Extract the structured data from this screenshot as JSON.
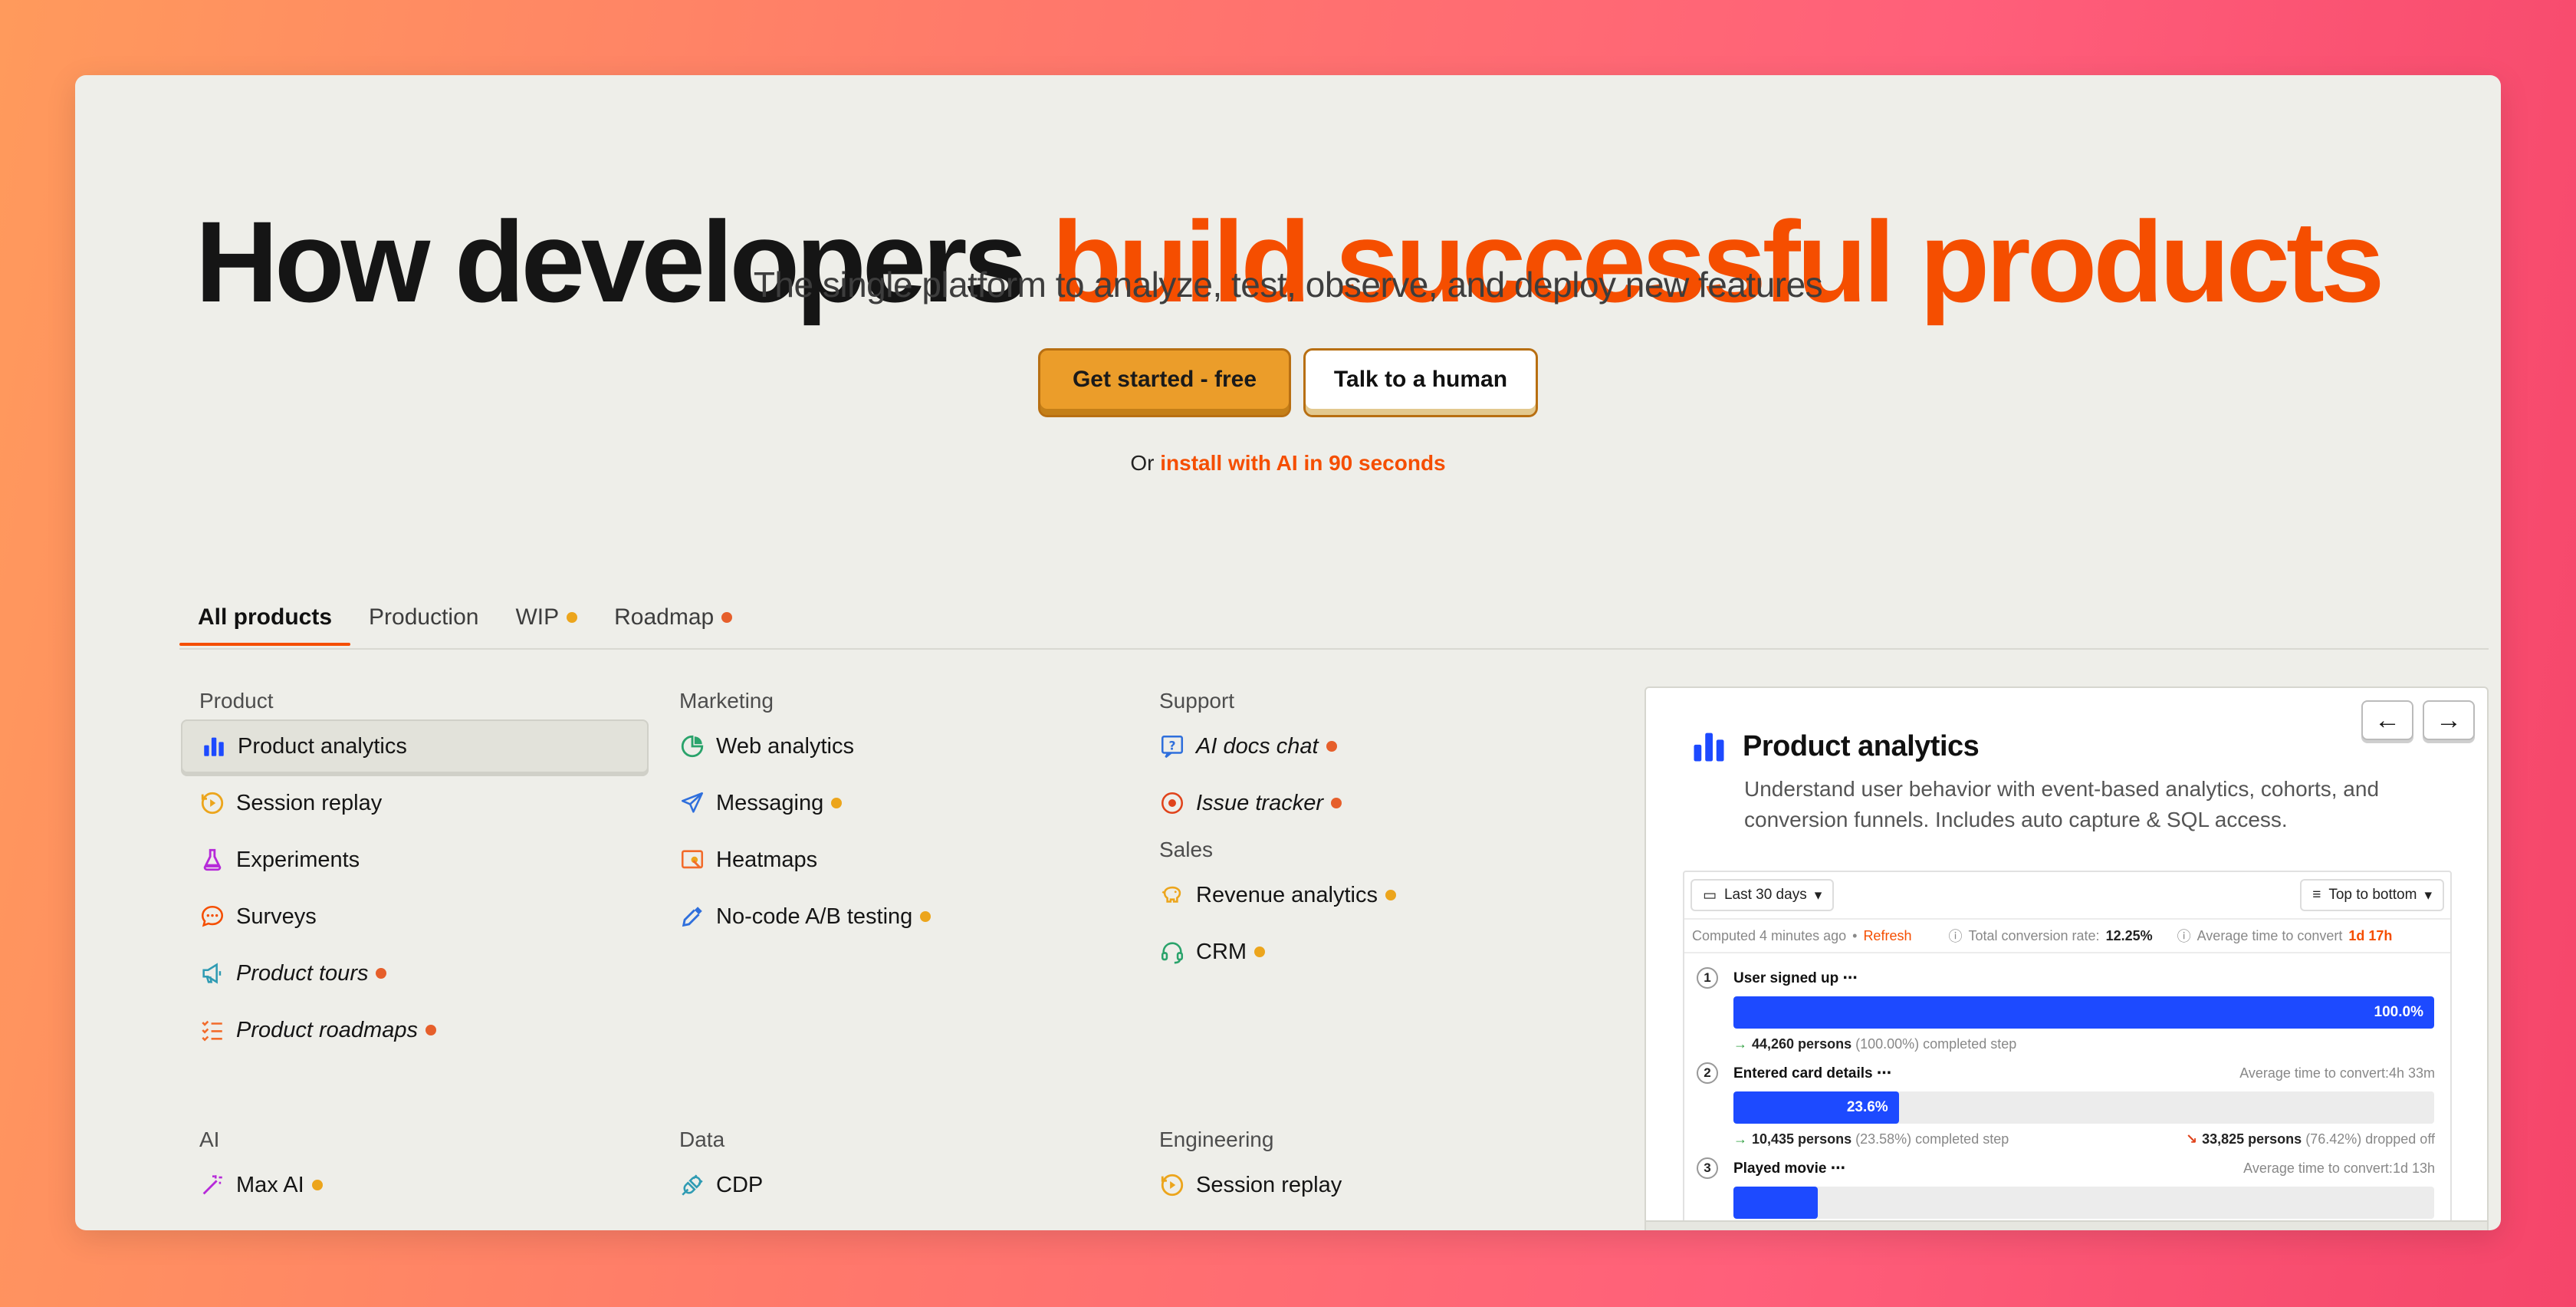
{
  "hero": {
    "title_main": "How developers ",
    "title_accent": "build successful products",
    "subtitle": "The single platform to analyze, test, observe, and deploy new features",
    "cta_primary": "Get started - free",
    "cta_secondary": "Talk to a human",
    "install_prefix": "Or ",
    "install_link": "install with AI in 90 seconds"
  },
  "tabs": [
    {
      "label": "All products",
      "active": true
    },
    {
      "label": "Production"
    },
    {
      "label": "WIP",
      "dot": "#eca51c"
    },
    {
      "label": "Roadmap",
      "dot": "#e65f2b"
    }
  ],
  "columns": {
    "product": {
      "heading": "Product",
      "items": [
        {
          "label": "Product analytics",
          "icon": "bar-chart-icon"
        },
        {
          "label": "Session replay",
          "icon": "replay-icon"
        },
        {
          "label": "Experiments",
          "icon": "flask-icon"
        },
        {
          "label": "Surveys",
          "icon": "chat-bubble-icon"
        },
        {
          "label": "Product tours",
          "icon": "megaphone-icon",
          "status": "roadmap"
        },
        {
          "label": "Product roadmaps",
          "icon": "checklist-icon",
          "status": "roadmap"
        }
      ]
    },
    "marketing": {
      "heading": "Marketing",
      "items": [
        {
          "label": "Web analytics",
          "icon": "pie-chart-icon"
        },
        {
          "label": "Messaging",
          "icon": "paper-plane-icon",
          "status": "wip"
        },
        {
          "label": "Heatmaps",
          "icon": "heatmap-icon"
        },
        {
          "label": "No-code A/B testing",
          "icon": "dropper-icon",
          "status": "wip"
        }
      ]
    },
    "support": {
      "heading": "Support",
      "items": [
        {
          "label": "AI docs chat",
          "icon": "help-doc-icon",
          "status": "roadmap"
        },
        {
          "label": "Issue tracker",
          "icon": "target-icon",
          "status": "roadmap"
        }
      ]
    },
    "sales": {
      "heading": "Sales",
      "items": [
        {
          "label": "Revenue analytics",
          "icon": "piggy-bank-icon",
          "status": "wip"
        },
        {
          "label": "CRM",
          "icon": "headset-icon",
          "status": "wip"
        }
      ]
    },
    "ai": {
      "heading": "AI",
      "items": [
        {
          "label": "Max AI",
          "icon": "magic-wand-icon",
          "status": "wip"
        }
      ]
    },
    "data": {
      "heading": "Data",
      "items": [
        {
          "label": "CDP",
          "icon": "plug-icon"
        }
      ]
    },
    "engineering": {
      "heading": "Engineering",
      "items": [
        {
          "label": "Session replay",
          "icon": "replay-icon"
        }
      ]
    }
  },
  "colors": {
    "accent": "#f54e00",
    "wip": "#eca51c",
    "roadmap": "#e65f2b",
    "funnel_bar": "#1d4aff"
  },
  "panel": {
    "title": "Product analytics",
    "description": "Understand user behavior with event-based analytics, cohorts, and conversion funnels. Includes auto capture & SQL access.",
    "prev_label": "←",
    "next_label": "→",
    "funnel": {
      "date_range": "Last 30 days",
      "layout": "Top to bottom",
      "computed": "Computed 4 minutes ago",
      "separator": "•",
      "refresh": "Refresh",
      "total_label": "Total conversion rate:",
      "total_value": "12.25%",
      "avg_label": "Average time to convert",
      "avg_value": "1d 17h",
      "steps": [
        {
          "num": "1",
          "name": "User signed up",
          "menu": "⋯",
          "pct": 100.0,
          "pct_label": "100.0%",
          "completed": "44,260 persons",
          "completed_pct": "(100.00%)",
          "completed_suffix": "completed step",
          "avg": "",
          "dropped": "",
          "dropped_pct": "",
          "dropped_suffix": ""
        },
        {
          "num": "2",
          "name": "Entered card details",
          "menu": "⋯",
          "pct": 23.6,
          "pct_label": "23.6%",
          "completed": "10,435 persons",
          "completed_pct": "(23.58%)",
          "completed_suffix": "completed step",
          "avg": "Average time to convert:4h 33m",
          "dropped": "33,825 persons",
          "dropped_pct": "(76.42%)",
          "dropped_suffix": "dropped off"
        },
        {
          "num": "3",
          "name": "Played movie",
          "menu": "⋯",
          "pct": 3.0,
          "pct_label": "",
          "avg": "Average time to convert:1d 13h"
        }
      ]
    }
  }
}
